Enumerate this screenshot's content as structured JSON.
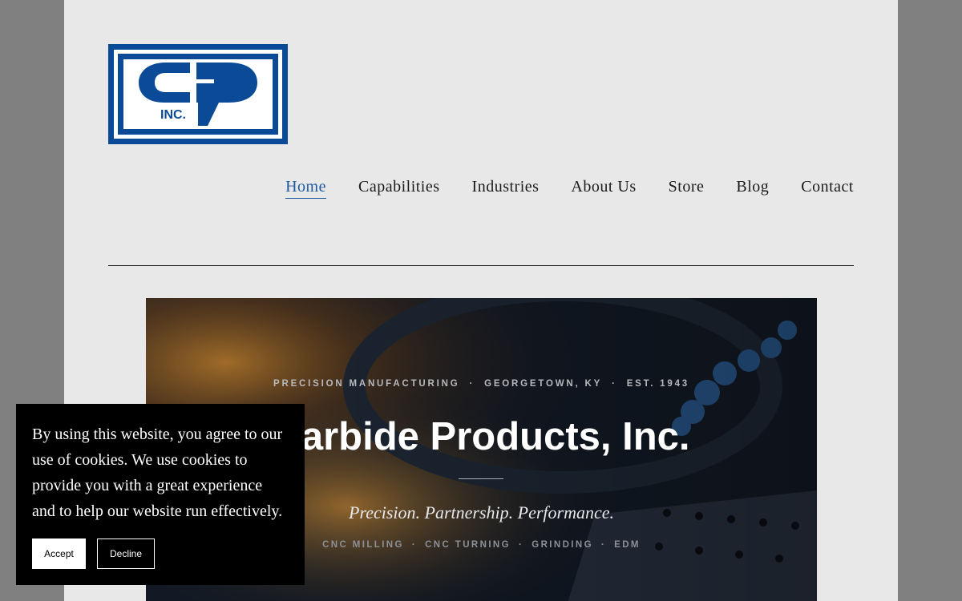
{
  "header": {
    "logo_text": "INC.",
    "brand_color": "#0a4a96"
  },
  "nav": {
    "items": [
      {
        "label": "Home",
        "active": true
      },
      {
        "label": "Capabilities",
        "active": false
      },
      {
        "label": "Industries",
        "active": false
      },
      {
        "label": "About Us",
        "active": false
      },
      {
        "label": "Store",
        "active": false
      },
      {
        "label": "Blog",
        "active": false
      },
      {
        "label": "Contact",
        "active": false
      }
    ],
    "active_color": "#1e5a9f"
  },
  "hero": {
    "eyebrow": [
      "PRECISION MANUFACTURING",
      "GEORGETOWN, KY",
      "EST. 1943"
    ],
    "eyebrow_separator": "·",
    "title": "Carbide Products, Inc.",
    "tagline": "Precision. Partnership. Performance.",
    "services": [
      "CNC MILLING",
      "CNC TURNING",
      "GRINDING",
      "EDM"
    ],
    "services_separator": "·"
  },
  "cookie_banner": {
    "message": "By using this website, you agree to our use of cookies. We use cookies to provide you with a great experience and to help our website run effectively.",
    "accept_label": "Accept",
    "decline_label": "Decline"
  }
}
